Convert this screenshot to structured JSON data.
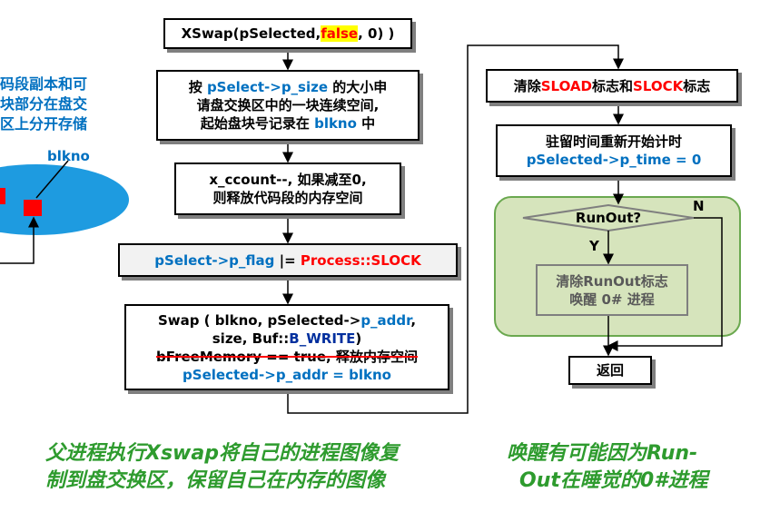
{
  "left": {
    "lines": [
      "码段副本和可",
      "块部分在盘交",
      "区上分开存储"
    ],
    "blkno_label": "blkno"
  },
  "flow_left": {
    "xswap": {
      "prefix": "XSwap(pSelected,",
      "arg": "false",
      "suffix": ", 0) )"
    },
    "box2": {
      "l1_a": "按 ",
      "l1_b": "pSelect->p_size",
      "l1_c": " 的大小申",
      "l2": "请盘交换区中的一块连续空间,",
      "l3_a": "起始盘块号记录在 ",
      "l3_b": "blkno",
      "l3_c": " 中"
    },
    "box3": {
      "l1": "x_ccount--, 如果减至0,",
      "l2": "则释放代码段的内存空间"
    },
    "box4": {
      "a": "pSelect->p_flag",
      "b": " |= ",
      "c": "Process::SLOCK"
    },
    "box5": {
      "l1_a": "Swap ( blkno, pSelected->",
      "l1_b": "p_addr",
      "l1_c": ",",
      "l2_a": "size, ",
      "l2_b": "Buf::",
      "l2_c": "B_WRITE",
      "l2_d": ")",
      "l3": "bFreeMemory == true, 释放内存空间",
      "l4_a": "pSelected->p_addr",
      "l4_b": " = blkno"
    }
  },
  "flow_right": {
    "clear": {
      "a": "清除",
      "b": "SLOAD",
      "c": "标志和",
      "d": "SLOCK",
      "e": "标志"
    },
    "reset": {
      "l1": "驻留时间重新开始计时",
      "l2": "pSelected->p_time = 0"
    },
    "decision": "RunOut?",
    "label_n": "N",
    "label_y": "Y",
    "wake": {
      "l1": "清除RunOut标志",
      "l2": "唤醒 0# 进程"
    },
    "ret": "返回"
  },
  "notes": {
    "left": [
      "父进程执行Xswap将自己的进程图像复",
      "制到盘交换区，保留自己在内存的图像"
    ],
    "right": [
      "唤醒有可能因为Run-",
      "Out在睡觉的0#进程"
    ]
  },
  "colors": {
    "blue": "#0070c0",
    "red": "#ff0000",
    "green_note": "#2e9b2e",
    "green_fill": "#d6e4bc",
    "green_border": "#6aa84f"
  }
}
